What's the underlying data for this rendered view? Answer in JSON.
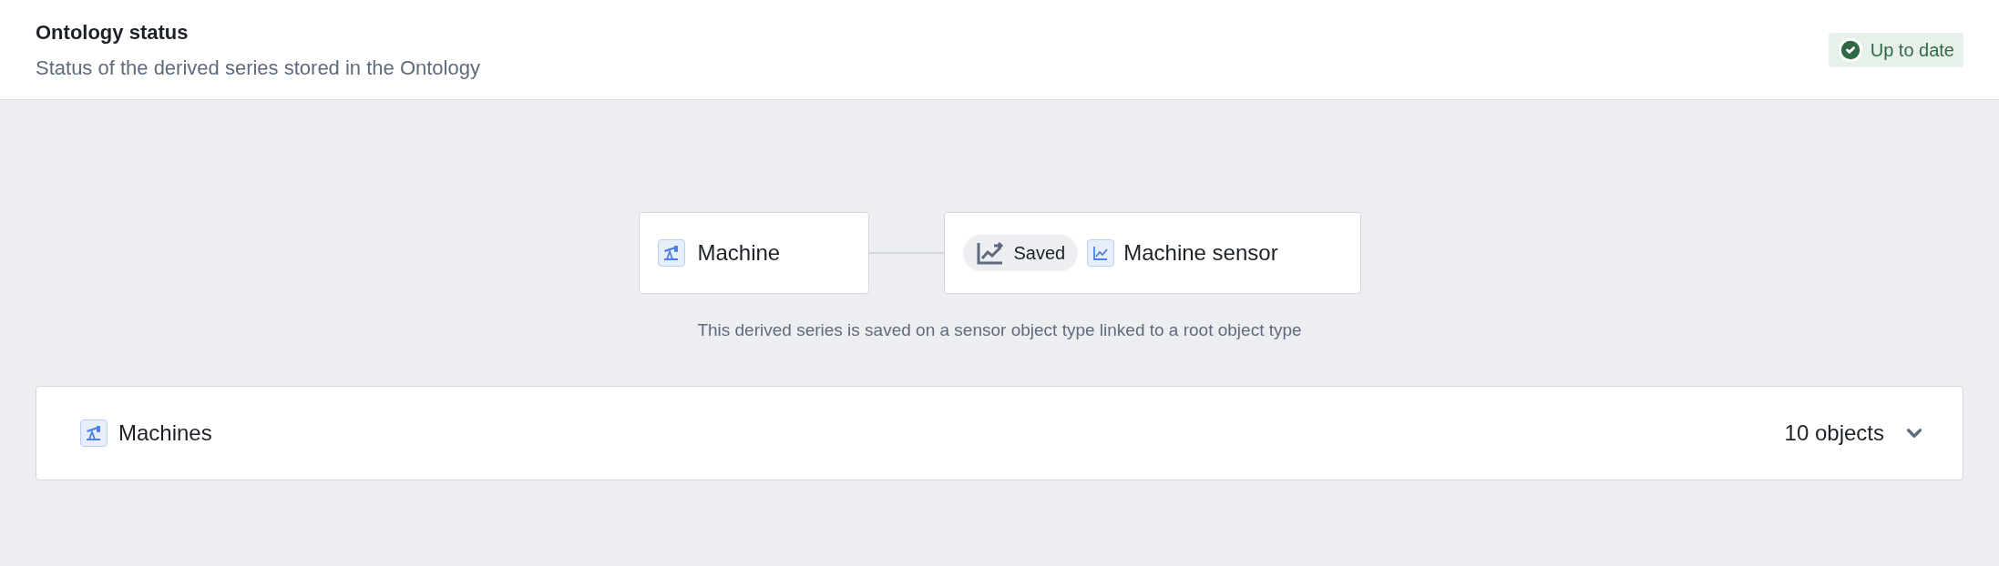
{
  "header": {
    "title": "Ontology status",
    "subtitle": "Status of the derived series stored in the Ontology",
    "status": {
      "label": "Up to date",
      "kind": "ok"
    }
  },
  "diagram": {
    "root": {
      "label": "Machine"
    },
    "sensor": {
      "badge": "Saved",
      "label": "Machine sensor"
    },
    "caption": "This derived series is saved on a sensor object type linked to a root object type"
  },
  "object_list": {
    "title": "Machines",
    "count": "10 objects",
    "expanded": false
  }
}
